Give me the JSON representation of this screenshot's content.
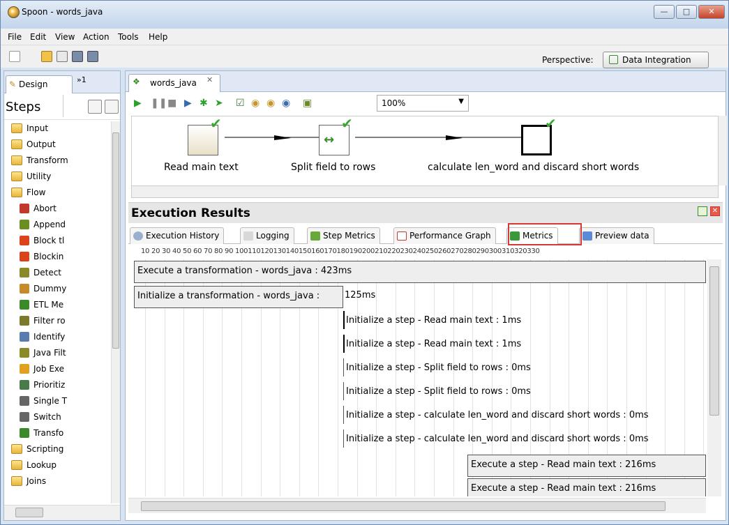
{
  "window": {
    "title": "Spoon - words_java"
  },
  "menu": [
    "File",
    "Edit",
    "View",
    "Action",
    "Tools",
    "Help"
  ],
  "perspective": {
    "label": "Perspective:",
    "value": "Data Integration"
  },
  "left": {
    "design_tab": "Design",
    "more_tab": "»1",
    "steps_label": "Steps",
    "tree": [
      {
        "label": "Input",
        "type": "folder"
      },
      {
        "label": "Output",
        "type": "folder"
      },
      {
        "label": "Transform",
        "type": "folder"
      },
      {
        "label": "Utility",
        "type": "folder"
      },
      {
        "label": "Flow",
        "type": "folder"
      },
      {
        "label": "Abort",
        "type": "step",
        "icon": "abort-icon",
        "color": "#c0392b"
      },
      {
        "label": "Append",
        "type": "step",
        "icon": "append-icon",
        "color": "#6b8e23"
      },
      {
        "label": "Block tl",
        "type": "step",
        "icon": "block-icon",
        "color": "#d9441c"
      },
      {
        "label": "Blockin",
        "type": "step",
        "icon": "blocking-icon",
        "color": "#d9441c"
      },
      {
        "label": "Detect",
        "type": "step",
        "icon": "detect-icon",
        "color": "#8a8a2a"
      },
      {
        "label": "Dummy",
        "type": "step",
        "icon": "dummy-icon",
        "color": "#c78a2a"
      },
      {
        "label": "ETL Me",
        "type": "step",
        "icon": "etl-icon",
        "color": "#3a8a2a"
      },
      {
        "label": "Filter ro",
        "type": "step",
        "icon": "filter-icon",
        "color": "#7a7a2a"
      },
      {
        "label": "Identify",
        "type": "step",
        "icon": "identify-icon",
        "color": "#5a7ab0"
      },
      {
        "label": "Java Filt",
        "type": "step",
        "icon": "java-filter-icon",
        "color": "#8a8a2a"
      },
      {
        "label": "Job Exe",
        "type": "step",
        "icon": "job-exec-icon",
        "color": "#e0a020"
      },
      {
        "label": "Prioritiz",
        "type": "step",
        "icon": "prioritize-icon",
        "color": "#4a7a4a"
      },
      {
        "label": "Single T",
        "type": "step",
        "icon": "single-icon",
        "color": "#666666"
      },
      {
        "label": "Switch",
        "type": "step",
        "icon": "switch-icon",
        "color": "#666666"
      },
      {
        "label": "Transfo",
        "type": "step",
        "icon": "transform-icon",
        "color": "#3a8a2a"
      },
      {
        "label": "Scripting",
        "type": "folder"
      },
      {
        "label": "Lookup",
        "type": "folder"
      },
      {
        "label": "Joins",
        "type": "folder"
      }
    ]
  },
  "editor": {
    "tab_label": "words_java",
    "zoom": "100%",
    "nodes": [
      {
        "label": "Read main text"
      },
      {
        "label": "Split field to rows"
      },
      {
        "label": "calculate len_word and discard short words"
      }
    ]
  },
  "results": {
    "title": "Execution Results",
    "tabs": [
      "Execution History",
      "Logging",
      "Step Metrics",
      "Performance Graph",
      "Metrics",
      "Preview data"
    ],
    "ruler": "10 20 30 40 50 60 70 80 90 100110120130140150160170180190200210220230240250260270280290300310320330",
    "rows": [
      {
        "text": "Execute a transformation - words_java : 423ms"
      },
      {
        "text": "Initialize a transformation - words_java :",
        "extra": "125ms"
      },
      {
        "text": "Initialize a step - Read main text : 1ms"
      },
      {
        "text": "Initialize a step - Read main text : 1ms"
      },
      {
        "text": "Initialize a step - Split field to rows : 0ms"
      },
      {
        "text": "Initialize a step - Split field to rows : 0ms"
      },
      {
        "text": "Initialize a step - calculate len_word and discard short words : 0ms"
      },
      {
        "text": "Initialize a step - calculate len_word and discard short words : 0ms"
      },
      {
        "text": "Execute a step - Read main text : 216ms"
      },
      {
        "text": "Execute a step - Read main text : 216ms"
      }
    ]
  },
  "colors": {
    "accent": "#d23a3a",
    "check": "#38a82b"
  }
}
